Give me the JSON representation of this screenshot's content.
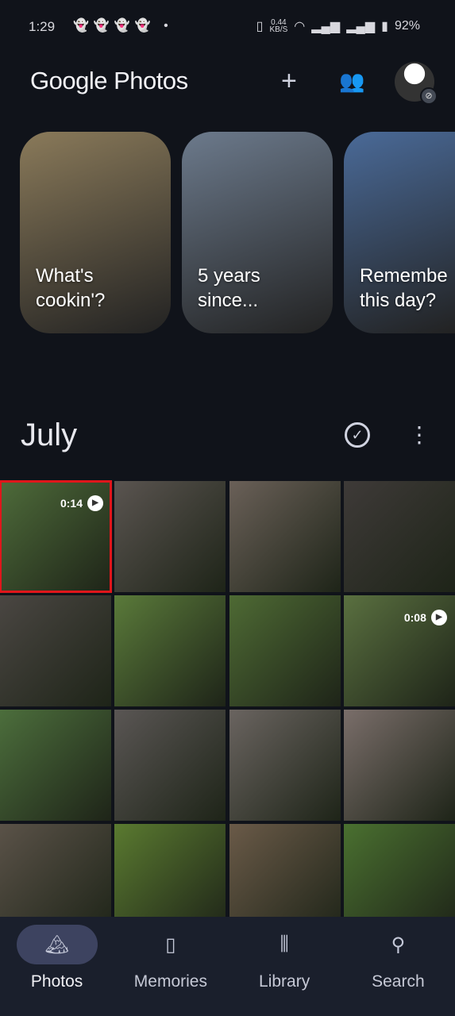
{
  "status": {
    "time": "1:29",
    "notif_icons": [
      "snapchat-icon",
      "snapchat-icon",
      "snapchat-icon",
      "snapchat-icon"
    ],
    "speed": "0.44",
    "speed_unit": "KB/S",
    "battery": "92%"
  },
  "header": {
    "title": "Google Photos",
    "add_icon": "plus-icon",
    "sharing_icon": "people-icon"
  },
  "memories": [
    {
      "label": "What's\ncookin'?",
      "color": "#8a7a5a"
    },
    {
      "label": "5 years\nsince...",
      "color": "#6c7a8c"
    },
    {
      "label": "Remembe\nthis day?",
      "color": "#4a6a98"
    }
  ],
  "section": {
    "month": "July"
  },
  "grid": [
    {
      "color": "#4e6b3a",
      "video": "0:14",
      "selected": true
    },
    {
      "color": "#5a5450"
    },
    {
      "color": "#6a6058"
    },
    {
      "color": "#3e3a38"
    },
    {
      "color": "#4a4642"
    },
    {
      "color": "#5a7a3a"
    },
    {
      "color": "#4e6a34"
    },
    {
      "color": "#5a7040",
      "video": "0:08"
    },
    {
      "color": "#4c6e3c"
    },
    {
      "color": "#5a5654"
    },
    {
      "color": "#6a6460"
    },
    {
      "color": "#7a6e6a"
    },
    {
      "color": "#5a5248"
    },
    {
      "color": "#5a7a30"
    },
    {
      "color": "#6a5a48"
    },
    {
      "color": "#4a7030"
    }
  ],
  "nav": [
    {
      "label": "Photos",
      "icon": "photo-icon",
      "active": true
    },
    {
      "label": "Memories",
      "icon": "memories-icon"
    },
    {
      "label": "Library",
      "icon": "library-icon"
    },
    {
      "label": "Search",
      "icon": "search-icon"
    }
  ]
}
